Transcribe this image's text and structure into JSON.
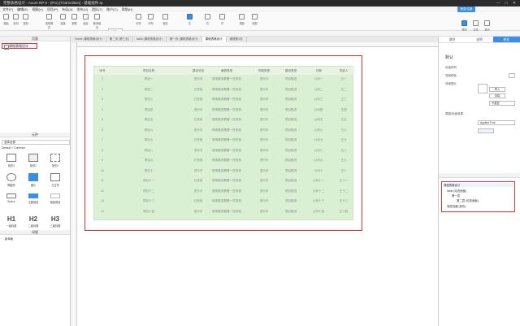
{
  "window": {
    "title": "完整表格设计 - Axure RP 9 - (Pro) [Trial Edition] - 基础组件.rp",
    "min": "—",
    "max": "□",
    "close": "✕"
  },
  "menu": [
    "文件(F)",
    "编辑(E)",
    "视图(V)",
    "项目(P)",
    "布局(A)",
    "发布(U)",
    "团队(T)",
    "账户(C)",
    "帮助(H)"
  ],
  "toolbar": {
    "zoom": "100%",
    "share_label": "登录/注册",
    "items": [
      "粘贴",
      "剪切",
      "复制",
      "选择模式",
      "连接",
      "钢笔",
      "组合",
      "取消组合",
      "对齐",
      "分布",
      "锁定",
      "左",
      "右",
      "中",
      "顶部",
      "底部",
      "预览",
      "共享",
      "发布"
    ]
  },
  "left": {
    "pages_header": "页面",
    "page_item": "课程表格设计",
    "library_header": "元件",
    "library_select": "选择全部",
    "library_group": "Default > Common",
    "widgets": [
      {
        "name": "矩形1",
        "kind": "rect"
      },
      {
        "name": "矩形2",
        "kind": "rect"
      },
      {
        "name": "矩形3",
        "kind": "rect"
      },
      {
        "name": "椭圆形",
        "kind": "ellipse"
      },
      {
        "name": "图片",
        "kind": "image"
      },
      {
        "name": "占位符",
        "kind": "placeholder"
      },
      {
        "name": "Button",
        "kind": "button"
      },
      {
        "name": "主要按钮",
        "kind": "button-primary"
      },
      {
        "name": "链接按钮",
        "kind": "link"
      },
      {
        "name": "一级标题",
        "kind": "h",
        "glyph": "H1"
      },
      {
        "name": "二级标题",
        "kind": "h",
        "glyph": "H2"
      },
      {
        "name": "三级标题",
        "kind": "h",
        "glyph": "H3"
      }
    ],
    "masters_header": "母版",
    "masters_item": "新母版"
  },
  "canvas": {
    "tabs": [
      "Home (课程表格设计)",
      "第二页 (第三页)",
      "table (课程表格设计)",
      "第一页 (课程表格设计)",
      "课程表格设计",
      "管理第1页"
    ],
    "active_tab": 4
  },
  "table": {
    "headers": [
      "序号",
      "项目名称",
      "建设状态",
      "隶属类型",
      "所属类型",
      "建设类型",
      "日期",
      "发起人"
    ],
    "rows": [
      [
        "1",
        "项目一",
        "进行中",
        "现场推进看着一任务到",
        "进行中",
        "项目推进",
        "公司一",
        "王一"
      ],
      [
        "2",
        "项目二",
        "已完成",
        "现场推进看着一任务到",
        "进行中",
        "项目推进",
        "公司二",
        "王二"
      ],
      [
        "3",
        "项目三",
        "已完成",
        "现场推进看着一任务到",
        "进行中",
        "项目推进",
        "公司三",
        "王三"
      ],
      [
        "4",
        "项目四",
        "进行中",
        "现场推进看着一任务到",
        "进行中",
        "项目推进",
        "公司四",
        "王四"
      ],
      [
        "5",
        "项目五",
        "已完成",
        "现场推进看着一任务到",
        "进行中",
        "项目推进",
        "公司五",
        "王五"
      ],
      [
        "6",
        "项目六",
        "进行中",
        "现场推进看着一任务到",
        "进行中",
        "项目推进",
        "公司六",
        "王六"
      ],
      [
        "7",
        "项目七",
        "已完成",
        "现场推进看着一任务到",
        "进行中",
        "项目推进",
        "公司七",
        "王七"
      ],
      [
        "8",
        "项目八",
        "进行中",
        "现场推进看着一任务到",
        "进行中",
        "项目推进",
        "公司八",
        "王八"
      ],
      [
        "9",
        "项目九",
        "已完成",
        "现场推进看着一任务到",
        "进行中",
        "项目推进",
        "公司九",
        "王九"
      ],
      [
        "10",
        "项目十",
        "进行中",
        "现场推进看着一任务到",
        "进行中",
        "项目推进",
        "公司十",
        "王十"
      ],
      [
        "11",
        "项目十一",
        "已完成",
        "现场推进看着一任务到",
        "进行中",
        "项目推进",
        "公司十一",
        "王十一"
      ],
      [
        "12",
        "项目十二",
        "进行中",
        "现场推进看着一任务到",
        "进行中",
        "项目推进",
        "公司十二",
        "王十二"
      ],
      [
        "13",
        "项目十三",
        "已完成",
        "现场推进看着一任务到",
        "进行中",
        "项目推进",
        "公司十三",
        "王十三"
      ],
      [
        "14",
        "项目十四",
        "进行中",
        "现场推进看着一任务到",
        "进行中",
        "项目推进",
        "公司十四",
        "王十四"
      ]
    ]
  },
  "right": {
    "tabs": [
      "属性",
      "说明",
      "样式"
    ],
    "active_tab": 2,
    "style_name": "默认",
    "page_align_label": "页面排列",
    "bg_color_label": "背景颜色",
    "bg_image_label": "背景图片",
    "import_button": "导入",
    "clear_button": "清除",
    "repeat_value": "不重复",
    "sketch_label": "草图/页面效果",
    "font_value": "Applied Font",
    "outline_title": "课程表格设计",
    "outline_items": [
      "table (动态面板)",
      "第一层",
      "第二层 (动态面板)",
      "底层容器 (矩形)"
    ],
    "colors": {
      "accent": "#3a8ee6",
      "table_bg": "#d9f0d3",
      "highlight": "#d33333"
    }
  }
}
